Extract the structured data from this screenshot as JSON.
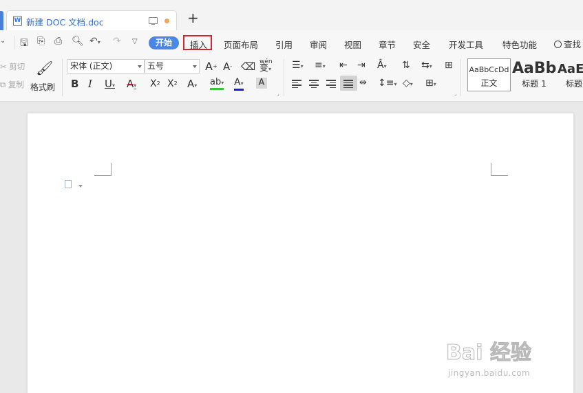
{
  "tabbar": {
    "document_tab_title": "新建 DOC 文档.doc",
    "document_icon_letter": "W",
    "new_tab_label": "+",
    "unsaved_dot_color": "#f0a45e"
  },
  "menu": {
    "start": "开始",
    "insert": "插入",
    "items": [
      "页面布局",
      "引用",
      "审阅",
      "视图",
      "章节",
      "安全",
      "开发工具",
      "特色功能"
    ],
    "search": "查找",
    "start_color": "#4a85e8",
    "highlight_color": "#d9232e"
  },
  "clipboard": {
    "cut": "剪切",
    "copy": "复制",
    "format_painter": "格式刷"
  },
  "font": {
    "family": "宋体 (正文)",
    "size": "五号",
    "grow": "A",
    "shrink": "A",
    "clear": "⌫",
    "phonetic": "wén",
    "bold": "B",
    "italic": "I",
    "underline": "U",
    "strike": "A",
    "superscript": "X",
    "subscript": "X",
    "effects": "A",
    "highlight": "ab",
    "font_color": "A",
    "char_shading": "A"
  },
  "styles": [
    {
      "sample": "AaBbCcDd",
      "name": "正文"
    },
    {
      "sample": "AaBb",
      "name": "标题 1"
    },
    {
      "sample": "AaE",
      "name": "标题"
    }
  ],
  "watermark": {
    "main": "Bai 经验",
    "sub": "jingyan.baidu.com"
  }
}
